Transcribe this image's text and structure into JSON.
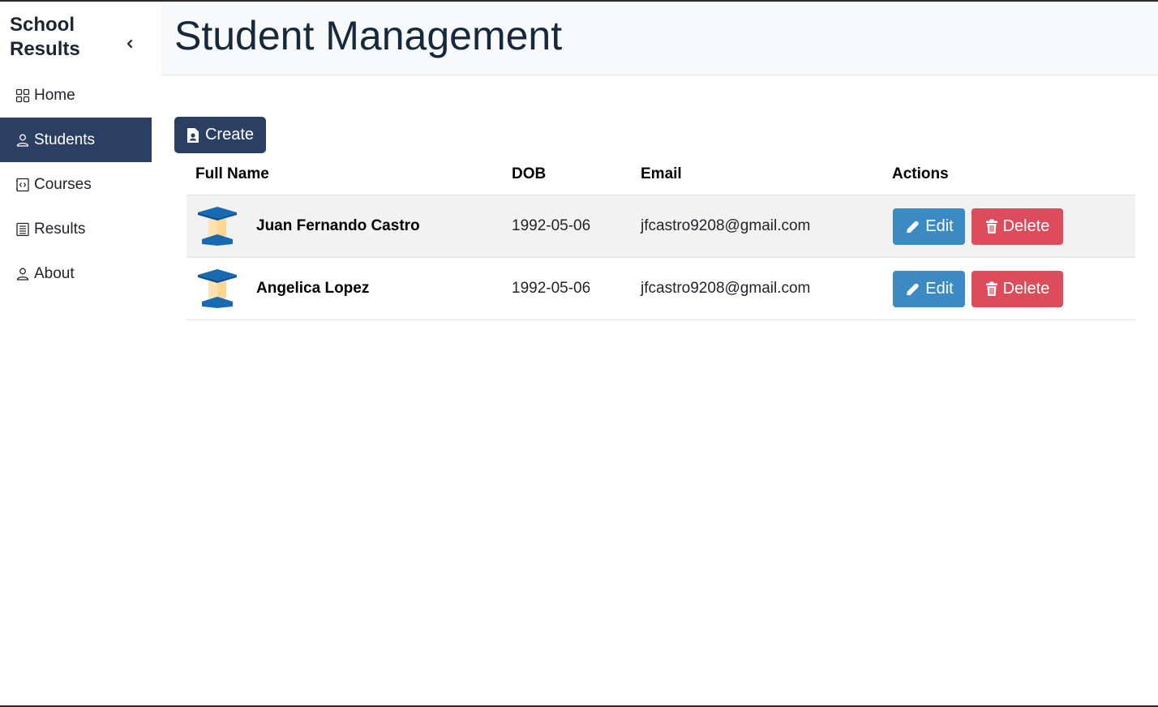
{
  "sidebar": {
    "brand_line1": "School",
    "brand_line2": "Results",
    "items": [
      {
        "label": "Home",
        "icon": "grid-icon"
      },
      {
        "label": "Students",
        "icon": "person-icon",
        "active": true
      },
      {
        "label": "Courses",
        "icon": "code-file-icon"
      },
      {
        "label": "Results",
        "icon": "list-document-icon"
      },
      {
        "label": "About",
        "icon": "person-icon"
      }
    ]
  },
  "header": {
    "title": "Student Management"
  },
  "toolbar": {
    "create_label": "Create"
  },
  "table": {
    "columns": [
      "Full Name",
      "DOB",
      "Email",
      "Actions"
    ],
    "rows": [
      {
        "name": "Juan Fernando Castro",
        "dob": "1992-05-06",
        "email": "jfcastro9208@gmail.com",
        "edit_label": "Edit",
        "delete_label": "Delete"
      },
      {
        "name": "Angelica Lopez",
        "dob": "1992-05-06",
        "email": "jfcastro9208@gmail.com",
        "edit_label": "Edit",
        "delete_label": "Delete"
      }
    ]
  },
  "colors": {
    "primary": "#2a3f62",
    "edit": "#3b8ac4",
    "delete": "#dc4c5c",
    "title": "#16283c"
  }
}
